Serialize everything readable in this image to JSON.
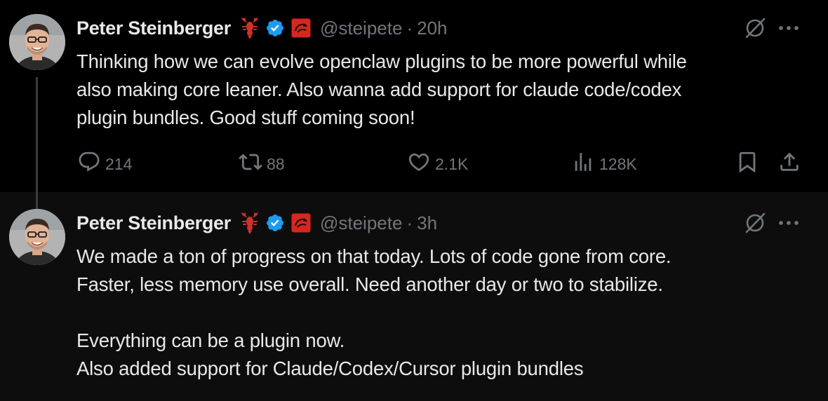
{
  "thread": [
    {
      "author_name": "Peter Steinberger",
      "handle": "@steipete",
      "separator": "·",
      "time": "20h",
      "text_lines": [
        "Thinking how we can evolve openclaw plugins to be more powerful while",
        "also making core leaner. Also wanna add support for claude code/codex",
        "plugin bundles. Good stuff coming soon!"
      ],
      "replies": "214",
      "reposts": "88",
      "likes": "2.1K",
      "views": "128K"
    },
    {
      "author_name": "Peter Steinberger",
      "handle": "@steipete",
      "separator": "·",
      "time": "3h",
      "text_lines": [
        "We made a ton of progress on that today. Lots of code gone from core.",
        "Faster, less memory use overall. Need another day or two to stabilize.",
        "",
        "Everything can be a plugin now.",
        "Also added support for Claude/Codex/Cursor plugin bundles"
      ]
    }
  ],
  "icons": {
    "name_emoji": "lobster-emoji-icon",
    "verified": "verified-badge-icon",
    "affiliate": "affiliate-badge-icon",
    "grok": "grok-icon",
    "more": "more-icon",
    "reply": "reply-icon",
    "repost": "repost-icon",
    "like": "like-icon",
    "views": "views-icon",
    "bookmark": "bookmark-icon",
    "share": "share-icon"
  },
  "colors": {
    "background": "#000000",
    "background_second": "#0d0d0d",
    "text_primary": "#e7e9ea",
    "text_secondary": "#71767b",
    "verified_blue": "#1d9bf0",
    "lobster_red": "#d0312d"
  }
}
